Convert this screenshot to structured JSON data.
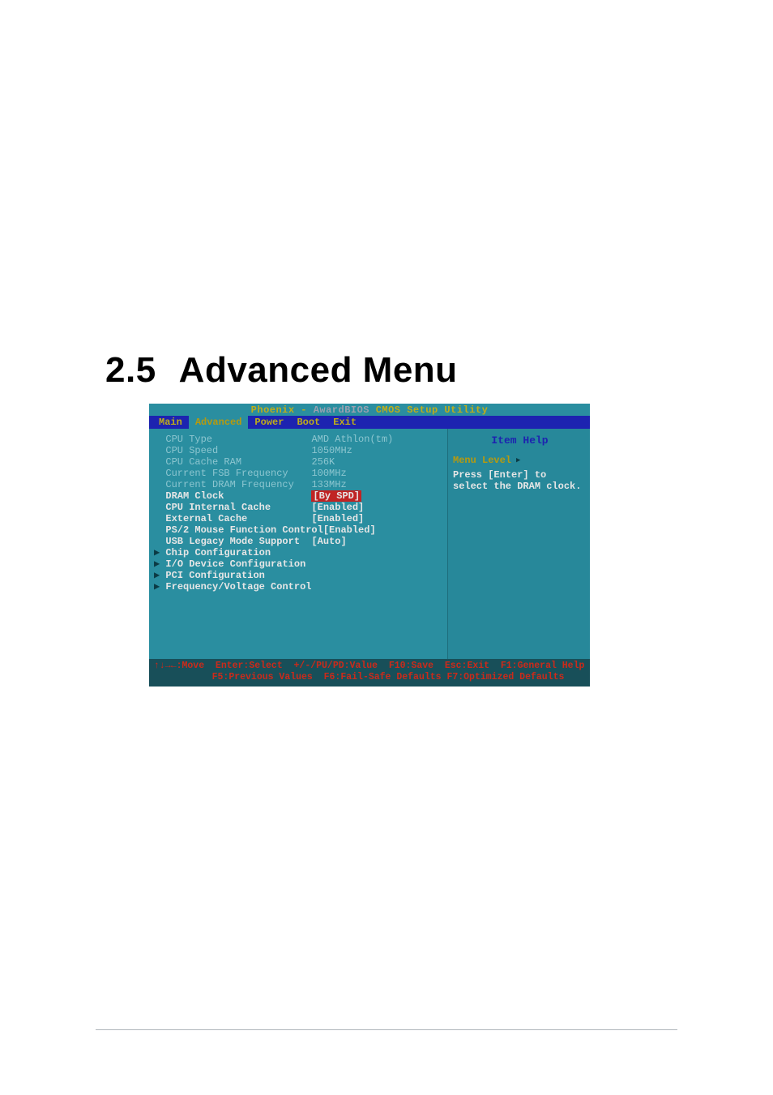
{
  "heading": {
    "number": "2.5",
    "title": "Advanced Menu"
  },
  "bios": {
    "title_left": "Phoenix - ",
    "title_mid": "AwardBIOS",
    "title_right": " CMOS Setup Utility",
    "tabs": [
      "Main",
      "Advanced",
      "Power",
      "Boot",
      "Exit"
    ],
    "selected_tab_index": 1,
    "rows_info": [
      {
        "label": "CPU Type",
        "value": "AMD Athlon(tm)"
      },
      {
        "label": "CPU Speed",
        "value": "1050MHz"
      },
      {
        "label": "CPU Cache RAM",
        "value": "256K"
      },
      {
        "label": "Current FSB Frequency",
        "value": "100MHz"
      },
      {
        "label": "Current DRAM Frequency",
        "value": "133MHz"
      }
    ],
    "rows_opt": [
      {
        "label": "DRAM Clock",
        "value": "[By SPD]",
        "highlight": true
      },
      {
        "label": "CPU Internal Cache",
        "value": "[Enabled]"
      },
      {
        "label": "External Cache",
        "value": "[Enabled]"
      },
      {
        "label": "PS/2 Mouse Function Control",
        "value": "[Enabled]"
      },
      {
        "label": "USB Legacy Mode Support",
        "value": "[Auto]"
      }
    ],
    "rows_sub": [
      {
        "label": "Chip Configuration"
      },
      {
        "label": "I/O Device Configuration"
      },
      {
        "label": "PCI Configuration"
      },
      {
        "label": "Frequency/Voltage Control"
      }
    ],
    "help": {
      "title": "Item Help",
      "menu_level_label": "Menu Level",
      "text1": "Press [Enter] to",
      "text2": "select the DRAM clock."
    },
    "footer": {
      "line1": "↑↓→←:Move  Enter:Select  +/-/PU/PD:Value  F10:Save  Esc:Exit  F1:General Help",
      "line2": "F5:Previous Values  F6:Fail-Safe Defaults F7:Optimized Defaults"
    }
  },
  "label_col_width": 27
}
